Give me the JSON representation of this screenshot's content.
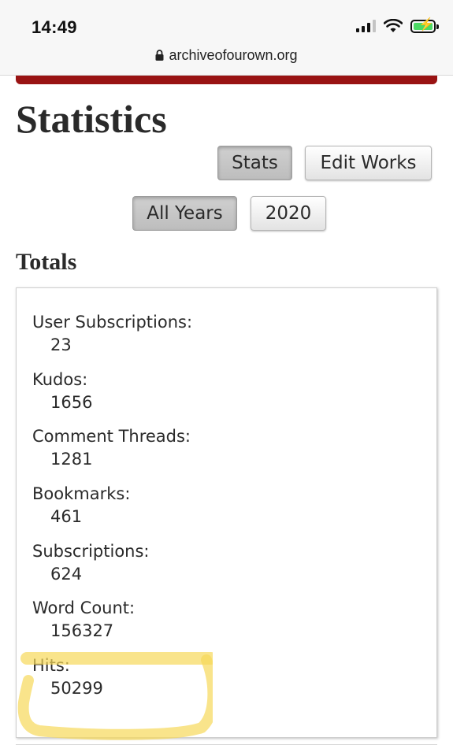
{
  "status_bar": {
    "time": "14:49",
    "signal_icon": "cellular-signal-icon",
    "wifi_icon": "wifi-icon",
    "battery_icon": "battery-charging-icon",
    "battery_color": "#4cd964"
  },
  "browser": {
    "url": "archiveofourown.org",
    "lock_icon": "lock-icon"
  },
  "header": {
    "accent_color": "#991313"
  },
  "page": {
    "title": "Statistics"
  },
  "view_buttons": {
    "stats_label": "Stats",
    "edit_works_label": "Edit Works",
    "active": "Stats"
  },
  "year_buttons": {
    "all_years_label": "All Years",
    "year_2020_label": "2020",
    "active": "All Years"
  },
  "totals": {
    "title": "Totals",
    "items": [
      {
        "label": "User Subscriptions:",
        "value": "23"
      },
      {
        "label": "Kudos:",
        "value": "1656"
      },
      {
        "label": "Comment Threads:",
        "value": "1281"
      },
      {
        "label": "Bookmarks:",
        "value": "461"
      },
      {
        "label": "Subscriptions:",
        "value": "624"
      },
      {
        "label": "Word Count:",
        "value": "156327"
      },
      {
        "label": "Hits:",
        "value": "50299"
      }
    ]
  },
  "annotation": {
    "highlight_color": "#f6d85a",
    "target": "Hits"
  }
}
